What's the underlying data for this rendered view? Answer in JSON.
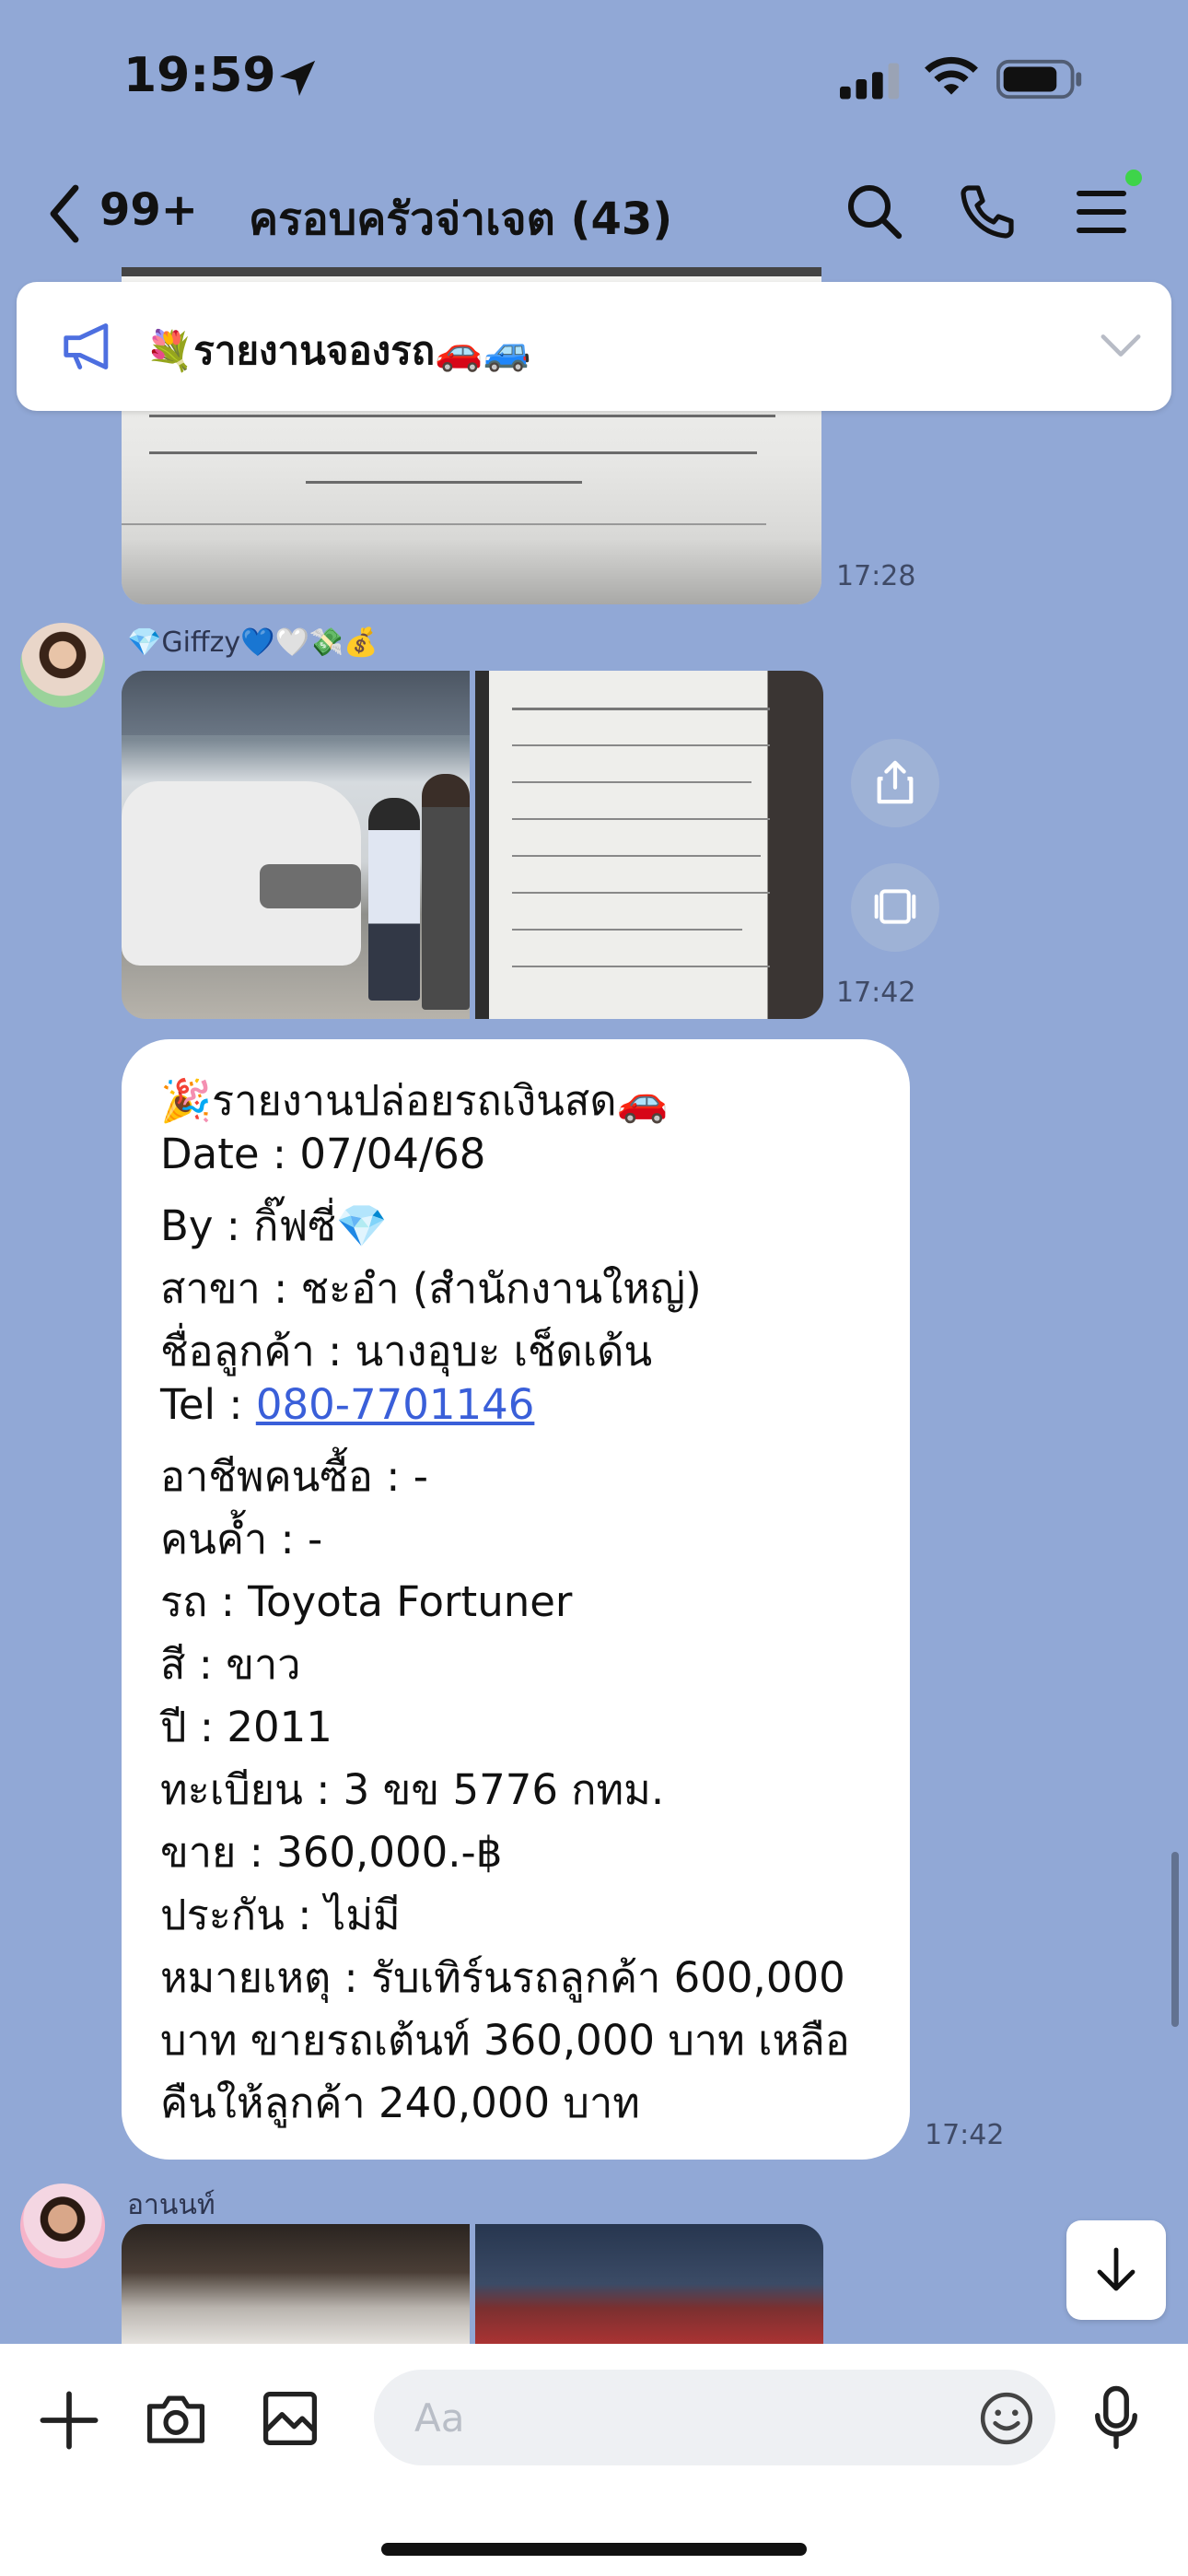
{
  "status_bar": {
    "time": "19:59"
  },
  "header": {
    "back_count": "99+",
    "title": "ครอบครัวจ่าเจต (43)"
  },
  "announcement": {
    "text": "💐รายงานจองรถ🚗🚙"
  },
  "messages": [
    {
      "type": "photo",
      "time": "17:28"
    },
    {
      "type": "photos",
      "sender": "💎Giffzy💙🤍💸💰",
      "time": "17:42"
    },
    {
      "type": "text",
      "time": "17:42",
      "lines": [
        "🎉รายงานปล่อยรถเงินสด🚗",
        "Date : 07/04/68",
        "By : กิ๊ฟซี่💎",
        "สาขา : ชะอำ (สำนักงานใหญ่)",
        "ชื่อลูกค้า : นางอุบะ เช็ดเด้น",
        "Tel : ",
        "อาชีพคนซื้อ : -",
        "คนค้ำ : -",
        "รถ : Toyota Fortuner",
        "สี : ขาว",
        "ปี : 2011",
        "ทะเบียน : 3 ขข 5776 กทม.",
        "ขาย : 360,000.-฿",
        "ประกัน : ไม่มี",
        "หมายเหตุ : รับเทิร์นรถลูกค้า 600,000",
        "บาท ขายรถเต้นท์ 360,000 บาท เหลือ",
        "คืนให้ลูกค้า 240,000 บาท"
      ],
      "phone": "080-7701146"
    },
    {
      "type": "photos",
      "sender": "อานนท์"
    }
  ],
  "input": {
    "placeholder": "Aa"
  },
  "icons": {
    "back": "chevron-left-icon",
    "search": "search-icon",
    "call": "phone-icon",
    "menu": "hamburger-icon",
    "announce": "megaphone-icon",
    "share": "share-icon",
    "album": "album-icon",
    "plus": "plus-icon",
    "camera": "camera-icon",
    "image": "image-icon",
    "emoji": "emoji-icon",
    "mic": "microphone-icon",
    "scroll": "arrow-down-icon"
  },
  "colors": {
    "chat_bg": "#91a8d6",
    "link": "#3a5fd9",
    "online_dot": "#3ed44a"
  }
}
